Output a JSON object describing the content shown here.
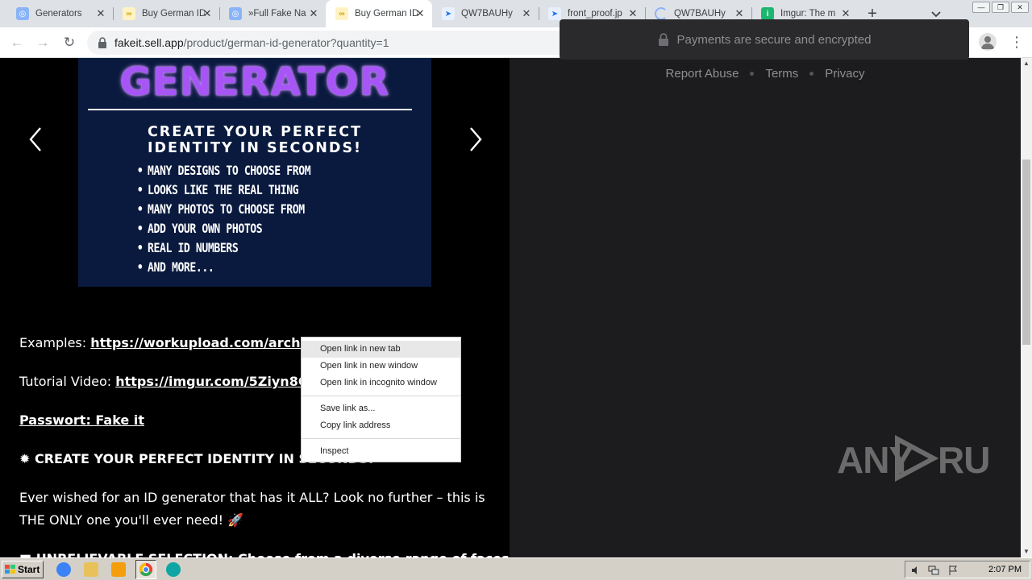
{
  "tabs": [
    {
      "label": "Generators",
      "favicon": "globe-icon",
      "active": false
    },
    {
      "label": "Buy German ID",
      "favicon": "sellapp-icon",
      "active": false
    },
    {
      "label": "»Full Fake Na",
      "favicon": "globe-icon",
      "active": false
    },
    {
      "label": "Buy German ID",
      "favicon": "sellapp-icon",
      "active": true
    },
    {
      "label": "QW7BAUHy",
      "favicon": "workupload-icon",
      "active": false
    },
    {
      "label": "front_proof.jp",
      "favicon": "workupload-icon",
      "active": false
    },
    {
      "label": "QW7BAUHy",
      "favicon": "loading-icon",
      "active": false
    },
    {
      "label": "Imgur: The m",
      "favicon": "imgur-icon",
      "active": false
    }
  ],
  "toolbar": {
    "url_domain": "fakeit.sell.app",
    "url_path": "/product/german-id-generator?quantity=1"
  },
  "product_image": {
    "title_word": "GENERATOR",
    "headline_line1": "CREATE YOUR PERFECT",
    "headline_line2": "IDENTITY IN SECONDS!",
    "bullets": [
      "MANY DESIGNS TO CHOOSE FROM",
      "LOOKS LIKE THE REAL THING",
      "MANY PHOTOS TO CHOOSE FROM",
      "ADD YOUR OWN PHOTOS",
      "REAL ID NUMBERS",
      "AND MORE..."
    ]
  },
  "description": {
    "examples_label": "Examples: ",
    "examples_link": "https://workupload.com/archive/QW7BAUHy",
    "tutorial_label": "Tutorial Video: ",
    "tutorial_link": "https://imgur.com/5Ziyn8G",
    "password_line": "Passwort: Fake it",
    "headline_emoji": "✹",
    "headline_text": " CREATE YOUR PERFECT IDENTITY IN SECONDS! ",
    "ever_wished": "Ever wished for an ID generator that has it ALL? Look no further – this is THE ONLY one you'll ever need! 🚀",
    "next_line": "■ UNBELIEVABLE SELECTION: Choose from a diverse range of faces (young"
  },
  "checkout": {
    "secure_text": "Payments are secure and encrypted",
    "footer_links": [
      "Report Abuse",
      "Terms",
      "Privacy"
    ]
  },
  "watermark": "ANY RUN",
  "context_menu": {
    "items": [
      {
        "label": "Open link in new tab",
        "hover": true
      },
      {
        "label": "Open link in new window",
        "hover": false
      },
      {
        "label": "Open link in incognito window",
        "hover": false
      },
      {
        "label": "Save link as...",
        "hover": false
      },
      {
        "label": "Copy link address",
        "hover": false
      },
      {
        "label": "Inspect",
        "hover": false
      }
    ]
  },
  "taskbar": {
    "start_label": "Start",
    "clock": "2:07 PM"
  }
}
